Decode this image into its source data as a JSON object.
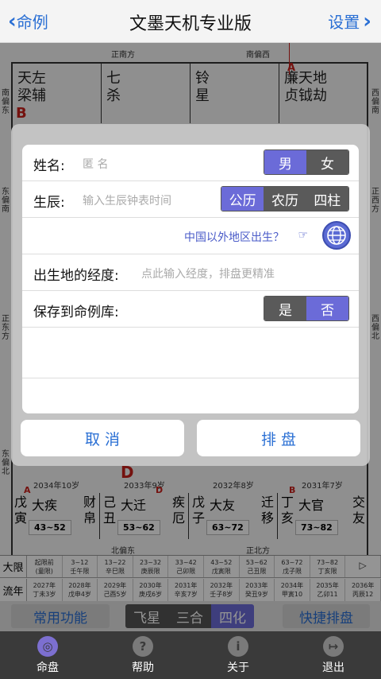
{
  "nav": {
    "back_label": "命例",
    "title": "文墨天机专业版",
    "settings_label": "设置"
  },
  "chart": {
    "dir_top_center": "正南方",
    "dir_top_right": "南偏西",
    "dir_left_top": "南偏东",
    "dir_left_mid": "东偏南",
    "dir_left_low": "正东方",
    "dir_left_bottom": "东偏北",
    "dir_right_top": "西偏南",
    "dir_right_mid": "正西方",
    "dir_right_low": "西偏北",
    "dir_bottom_left": "北偏东",
    "dir_bottom_right": "正北方",
    "top_palaces": [
      {
        "stars": "天左\n梁辅"
      },
      {
        "stars": "七\n杀"
      },
      {
        "stars": "铃\n星"
      },
      {
        "stars": "廉天地\n贞钺劫"
      }
    ],
    "letters": {
      "a_top": "A",
      "b": "B",
      "a_bottom": "A",
      "d_marker": "D",
      "d_small": "D",
      "b_bottom": "B"
    },
    "ages": [
      "2034年10岁",
      "2033年9岁",
      "2032年8岁",
      "2031年7岁"
    ],
    "bottom_palaces": [
      {
        "stem": "戊寅",
        "name": "大疾",
        "range": "43~52",
        "side": "财帛"
      },
      {
        "stem": "己丑",
        "name": "大迁",
        "range": "53~62",
        "side": "疾厄"
      },
      {
        "stem": "戊子",
        "name": "大友",
        "range": "63~72",
        "side": "迁移"
      },
      {
        "stem": "丁亥",
        "name": "大官",
        "range": "73~82",
        "side": "交友"
      }
    ]
  },
  "timeline": {
    "row1_label": "大限",
    "row1": [
      "起限前\n(童限)",
      "3~12\n壬午限",
      "13~22\n辛巳限",
      "23~32\n庚辰限",
      "33~42\n己卯限",
      "43~52\n戊寅限",
      "53~62\n己丑限",
      "63~72\n戊子限",
      "73~82\n丁亥限",
      "▷"
    ],
    "row2_label": "流年",
    "row2": [
      "2027年\n丁未3岁",
      "2028年\n戊申4岁",
      "2029年\n己酉5岁",
      "2030年\n庚戌6岁",
      "2031年\n辛亥7岁",
      "2032年\n壬子8岁",
      "2033年\n癸丑9岁",
      "2034年\n甲寅10",
      "2035年\n乙卯11",
      "2036年\n丙辰12"
    ]
  },
  "actions": {
    "common": "常用功能",
    "modes": [
      "飞星",
      "三合",
      "四化"
    ],
    "quick": "快捷排盘"
  },
  "tabs": [
    {
      "label": "命盘",
      "icon": "compass-icon",
      "glyph": "◎"
    },
    {
      "label": "帮助",
      "icon": "help-icon",
      "glyph": "?"
    },
    {
      "label": "关于",
      "icon": "info-icon",
      "glyph": "i"
    },
    {
      "label": "退出",
      "icon": "exit-icon",
      "glyph": "↦"
    }
  ],
  "dialog": {
    "name_label": "姓名:",
    "name_placeholder": "匿 名",
    "gender_male": "男",
    "gender_female": "女",
    "birth_label": "生辰:",
    "birth_placeholder": "输入生辰钟表时间",
    "cal_solar": "公历",
    "cal_lunar": "农历",
    "cal_pillars": "四柱",
    "abroad_link": "中国以外地区出生？",
    "abroad_hand": "☞",
    "longitude_label": "出生地的经度:",
    "longitude_placeholder": "点此输入经度，排盘更精准",
    "save_label": "保存到命例库:",
    "save_yes": "是",
    "save_no": "否",
    "cancel": "取 消",
    "submit": "排 盘"
  }
}
